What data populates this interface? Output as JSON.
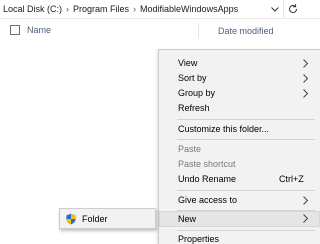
{
  "address": {
    "crumbs": [
      "Local Disk (C:)",
      "Program Files",
      "ModifiableWindowsApps"
    ],
    "separator": "›"
  },
  "columns": {
    "name": "Name",
    "date_modified": "Date modified"
  },
  "context_menu": {
    "view": "View",
    "sort_by": "Sort by",
    "group_by": "Group by",
    "refresh": "Refresh",
    "customize": "Customize this folder...",
    "paste": "Paste",
    "paste_shortcut": "Paste shortcut",
    "undo_rename": "Undo Rename",
    "undo_shortcut": "Ctrl+Z",
    "give_access": "Give access to",
    "new": "New",
    "properties": "Properties"
  },
  "submenu": {
    "folder": "Folder"
  },
  "colors": {
    "header_text": "#4d6082",
    "menu_bg": "#f2f2f2",
    "disabled_text": "#7a7a7a",
    "shield_blue": "#2b6cd4",
    "shield_yellow": "#f2c200"
  }
}
